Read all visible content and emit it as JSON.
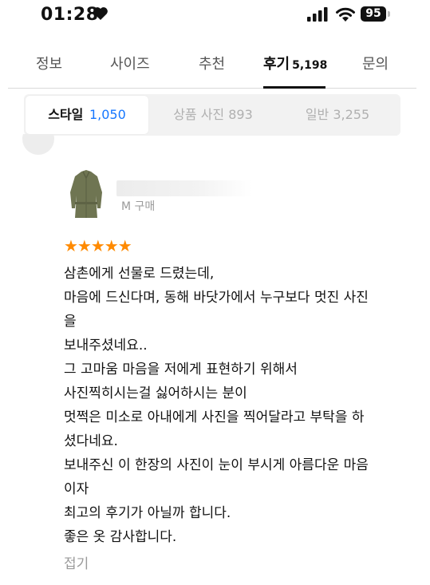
{
  "status_bar": {
    "time": "01:28",
    "battery": "95"
  },
  "tabs": [
    {
      "label": "정보",
      "count": ""
    },
    {
      "label": "사이즈",
      "count": ""
    },
    {
      "label": "추천",
      "count": ""
    },
    {
      "label": "후기",
      "count": "5,198"
    },
    {
      "label": "문의",
      "count": ""
    }
  ],
  "subtabs": [
    {
      "label": "스타일",
      "count": "1,050"
    },
    {
      "label": "상품 사진",
      "count": "893"
    },
    {
      "label": "일반",
      "count": "3,255"
    }
  ],
  "review": {
    "purchase_info": "M 구매",
    "rating": 5,
    "stars_text": "★★★★★",
    "lines": [
      "삼촌에게 선물로 드렸는데,",
      "마음에 드신다며, 동해 바닷가에서 누구보다 멋진 사진",
      "을",
      "보내주셨네요..",
      "그 고마움 마음을 저에게 표현하기 위해서",
      "사진찍히시는걸 싫어하시는 분이",
      "멋쩍은 미소로 아내에게 사진을 찍어달라고 부탁을 하",
      "셨다네요.",
      "보내주신 이 한장의 사진이 눈이 부시게 아름다운 마음",
      "이자",
      "최고의 후기가 아닐까 합니다.",
      "좋은 옷 감사합니다."
    ],
    "collapse_label": "접기"
  },
  "colors": {
    "star": "#ff8a00",
    "count_blue": "#1677ff",
    "muted": "#9a9a9a"
  }
}
